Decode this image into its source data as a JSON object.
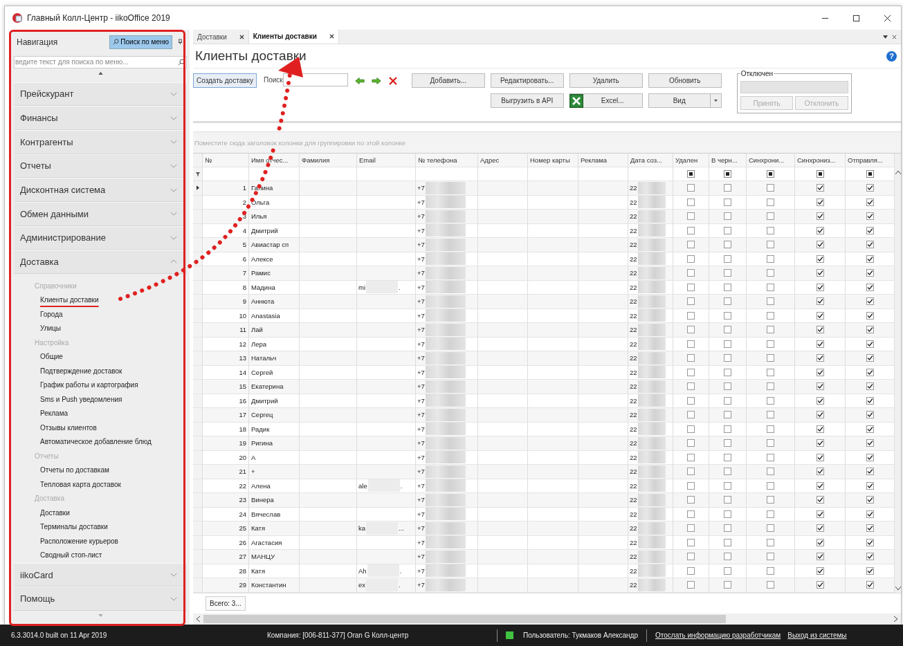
{
  "window": {
    "title": "Главный Колл-Центр - iikoOffice 2019"
  },
  "navigation": {
    "title": "Навигация",
    "search_button": "Поиск по меню",
    "search_placeholder": "ведите текст для поиска по меню...",
    "sections": [
      {
        "label": "Прейскурант",
        "expanded": false
      },
      {
        "label": "Финансы",
        "expanded": false
      },
      {
        "label": "Контрагенты",
        "expanded": false
      },
      {
        "label": "Отчеты",
        "expanded": false
      },
      {
        "label": "Дисконтная система",
        "expanded": false
      },
      {
        "label": "Обмен данными",
        "expanded": false
      },
      {
        "label": "Администрирование",
        "expanded": false
      },
      {
        "label": "Доставка",
        "expanded": true,
        "groups": [
          {
            "heading": "Справочники",
            "items": [
              {
                "label": "Клиенты доставки",
                "selected": true
              },
              {
                "label": "Города",
                "selected": false
              },
              {
                "label": "Улицы",
                "selected": false
              }
            ]
          },
          {
            "heading": "Настройка",
            "items": [
              {
                "label": "Общие",
                "selected": false
              },
              {
                "label": "Подтверждение доставок",
                "selected": false
              },
              {
                "label": "График работы и картография",
                "selected": false
              },
              {
                "label": "Sms и Push уведомления",
                "selected": false
              },
              {
                "label": "Реклама",
                "selected": false
              },
              {
                "label": "Отзывы клиентов",
                "selected": false
              },
              {
                "label": "Автоматическое добавление блюд",
                "selected": false
              }
            ]
          },
          {
            "heading": "Отчеты",
            "items": [
              {
                "label": "Отчеты по доставкам",
                "selected": false
              },
              {
                "label": "Тепловая карта доставок",
                "selected": false
              }
            ]
          },
          {
            "heading": "Доставка",
            "items": [
              {
                "label": "Доставки",
                "selected": false
              },
              {
                "label": "Терминалы доставки",
                "selected": false
              },
              {
                "label": "Расположение курьеров",
                "selected": false
              },
              {
                "label": "Сводный стоп-лист",
                "selected": false
              }
            ]
          }
        ]
      }
    ],
    "bottom_sections": [
      {
        "label": "iikoCard",
        "expanded": false
      },
      {
        "label": "Помощь",
        "expanded": false
      }
    ]
  },
  "tabs": [
    {
      "label": "Доставки",
      "selected": false
    },
    {
      "label": "Клиенты доставки",
      "selected": true
    }
  ],
  "page_title": "Клиенты доставки",
  "help": "?",
  "toolbar": {
    "create_button": "Создать доставку",
    "search_label": "Поиск",
    "buttons_row1": [
      "Добавить...",
      "Редактировать...",
      "Удалить",
      "Обновить"
    ],
    "buttons_row2": [
      "Выгрузить в API",
      "Excel...",
      "Вид"
    ]
  },
  "disabled_group": {
    "title": "Отключен",
    "buttons": [
      "Принять",
      "Отклонить"
    ]
  },
  "group_hint": "Поместите сюда заголовок колонки для группировки по этой колонке",
  "columns": [
    "№",
    "Имя отчес...",
    "Фамилия",
    "Email",
    "№ телефона",
    "Адрес",
    "Номер карты",
    "Реклама",
    "Дата соз...",
    "Удален",
    "В черн...",
    "Синхрони...",
    "Синхрониз...",
    "Отправля..."
  ],
  "rows": [
    {
      "num": "1",
      "name": "Галина",
      "phone": "+7",
      "date": "22",
      "checks": [
        false,
        false,
        false,
        true,
        true
      ],
      "selected": true
    },
    {
      "num": "2",
      "name": "Ольга",
      "phone": "+7",
      "date": "22",
      "checks": [
        false,
        false,
        false,
        true,
        true
      ],
      "selected": false
    },
    {
      "num": "3",
      "name": "Илья",
      "phone": "+7",
      "date": "22",
      "checks": [
        false,
        false,
        false,
        true,
        true
      ],
      "selected": false
    },
    {
      "num": "4",
      "name": "Дмитрий",
      "phone": "+7",
      "date": "22",
      "checks": [
        false,
        false,
        false,
        true,
        true
      ],
      "selected": false
    },
    {
      "num": "5",
      "name": "Авиастар сп",
      "phone": "+7",
      "date": "22",
      "checks": [
        false,
        false,
        false,
        true,
        true
      ],
      "selected": false
    },
    {
      "num": "6",
      "name": "Алексе",
      "phone": "+7",
      "date": "22",
      "checks": [
        false,
        false,
        false,
        true,
        true
      ],
      "selected": false
    },
    {
      "num": "7",
      "name": "Рамис",
      "phone": "+7",
      "date": "22",
      "checks": [
        false,
        false,
        false,
        true,
        true
      ],
      "selected": false
    },
    {
      "num": "8",
      "name": "Мадина",
      "email": "mi",
      "email_tail": ".",
      "phone": "+7",
      "date": "22",
      "checks": [
        false,
        false,
        false,
        true,
        true
      ],
      "selected": false
    },
    {
      "num": "9",
      "name": "Аннюта",
      "phone": "+7",
      "date": "22",
      "checks": [
        false,
        false,
        false,
        true,
        true
      ],
      "selected": false
    },
    {
      "num": "10",
      "name": "Anastasia",
      "phone": "+7",
      "date": "22",
      "checks": [
        false,
        false,
        false,
        true,
        true
      ],
      "selected": false
    },
    {
      "num": "11",
      "name": "Лай",
      "phone": "+7",
      "date": "22",
      "checks": [
        false,
        false,
        false,
        true,
        true
      ],
      "selected": false
    },
    {
      "num": "12",
      "name": "Лера",
      "phone": "+7",
      "date": "22",
      "checks": [
        false,
        false,
        false,
        true,
        true
      ],
      "selected": false
    },
    {
      "num": "13",
      "name": "Натальч",
      "phone": "+7",
      "date": "22",
      "checks": [
        false,
        false,
        false,
        true,
        true
      ],
      "selected": false
    },
    {
      "num": "14",
      "name": "Сергей",
      "phone": "+7",
      "date": "22",
      "checks": [
        false,
        false,
        false,
        true,
        true
      ],
      "selected": false
    },
    {
      "num": "15",
      "name": "Екатерина",
      "phone": "+7",
      "date": "22",
      "checks": [
        false,
        false,
        false,
        true,
        true
      ],
      "selected": false
    },
    {
      "num": "16",
      "name": "Дмитрий",
      "phone": "+7",
      "date": "22",
      "checks": [
        false,
        false,
        false,
        true,
        true
      ],
      "selected": false
    },
    {
      "num": "17",
      "name": "Сергец",
      "phone": "+7",
      "date": "22",
      "checks": [
        false,
        false,
        false,
        true,
        true
      ],
      "selected": false
    },
    {
      "num": "18",
      "name": "Радик",
      "phone": "+7",
      "date": "22",
      "checks": [
        false,
        false,
        false,
        true,
        true
      ],
      "selected": false
    },
    {
      "num": "19",
      "name": "Ригина",
      "phone": "+7",
      "date": "22",
      "checks": [
        false,
        false,
        false,
        true,
        true
      ],
      "selected": false
    },
    {
      "num": "20",
      "name": "А",
      "phone": "+7",
      "date": "22",
      "checks": [
        false,
        false,
        false,
        true,
        true
      ],
      "selected": false
    },
    {
      "num": "21",
      "name": "+",
      "phone": "+7",
      "date": "22",
      "checks": [
        false,
        false,
        false,
        true,
        true
      ],
      "selected": false
    },
    {
      "num": "22",
      "name": "Алена",
      "email": "ale",
      "email_tail": ".",
      "phone": "+7",
      "date": "22",
      "checks": [
        false,
        false,
        false,
        true,
        true
      ],
      "selected": false
    },
    {
      "num": "23",
      "name": "Винера",
      "phone": "+7",
      "date": "22",
      "checks": [
        false,
        false,
        false,
        true,
        true
      ],
      "selected": false
    },
    {
      "num": "24",
      "name": "Вячеслав",
      "phone": "+7",
      "date": "22",
      "checks": [
        false,
        false,
        false,
        true,
        true
      ],
      "selected": false
    },
    {
      "num": "25",
      "name": "Катя",
      "email": "ka",
      "email_tail": "...",
      "phone": "+7",
      "date": "22",
      "checks": [
        false,
        false,
        false,
        true,
        true
      ],
      "selected": false
    },
    {
      "num": "26",
      "name": "Агастасия",
      "phone": "+7",
      "date": "22",
      "checks": [
        false,
        false,
        false,
        true,
        true
      ],
      "selected": false
    },
    {
      "num": "27",
      "name": "МАНЦУ",
      "phone": "+7",
      "date": "22",
      "checks": [
        false,
        false,
        false,
        true,
        true
      ],
      "selected": false
    },
    {
      "num": "28",
      "name": "Катя",
      "email": "Ah",
      "email_tail": ".",
      "phone": "+7",
      "date": "22",
      "checks": [
        false,
        false,
        false,
        true,
        true
      ],
      "selected": false
    },
    {
      "num": "29",
      "name": "Константин",
      "email": "ex",
      "email_tail": ".",
      "phone": "+7",
      "date": "22",
      "checks": [
        false,
        false,
        false,
        true,
        true
      ],
      "selected": false
    }
  ],
  "total": "Всего: 3...",
  "status_bar": {
    "version": "6.3.3014.0 built on 11 Apr 2019",
    "company": "Компания: [006-811-377] Oran G Колл-центр",
    "user": "Пользователь: Тукмаков Александр",
    "links": [
      "Отослать информацию разработчикам",
      "Выход из системы"
    ]
  }
}
